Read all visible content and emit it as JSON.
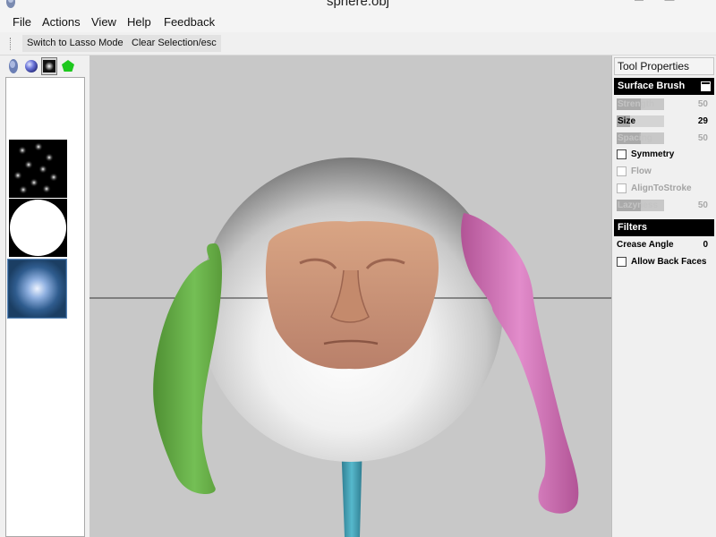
{
  "window": {
    "title": "sphere.obj",
    "app_icon": "sculptris-head-icon"
  },
  "menu": [
    "File",
    "Actions",
    "View",
    "Help",
    "Feedback"
  ],
  "toolbar": {
    "lasso_label": "Switch to Lasso Mode",
    "clear_label": "Clear Selection/esc"
  },
  "left_panel": {
    "tabs": [
      "brush-head-icon",
      "material-sphere-icon",
      "alpha-stamp-icon",
      "pentagon-shape-icon"
    ],
    "active_tab": 2,
    "alphas": [
      "scattered-dots-alpha",
      "solid-circle-alpha",
      "soft-falloff-alpha"
    ],
    "selected_alpha": 2
  },
  "tool_properties": {
    "title": "Tool Properties",
    "brush": "Surface Brush",
    "sliders": [
      {
        "label": "Strength",
        "value": "50",
        "enabled": false,
        "fraction": 0.5
      },
      {
        "label": "Size",
        "value": "29",
        "enabled": true,
        "fraction": 0.29
      },
      {
        "label": "Spacing",
        "value": "50",
        "enabled": false,
        "fraction": 0.5
      },
      {
        "label": "Lazyness",
        "value": "50",
        "enabled": false,
        "fraction": 0.5
      }
    ],
    "checkboxes": [
      {
        "label": "Symmetry",
        "enabled": true,
        "checked": false
      },
      {
        "label": "Flow",
        "enabled": false,
        "checked": false
      },
      {
        "label": "AlignToStroke",
        "enabled": false,
        "checked": false
      }
    ],
    "filters": {
      "title": "Filters",
      "crease_label": "Crease Angle",
      "crease_value": "0",
      "backfaces_label": "Allow Back Faces",
      "backfaces_checked": false
    }
  },
  "viewport": {
    "background_color": "#c8c8c8",
    "model_colors": {
      "sphere": "#e8e8e8",
      "face": "#c89070",
      "left_arm": "#6ab04c",
      "right_arm": "#d06cb0",
      "stem": "#3e9fb3"
    }
  }
}
